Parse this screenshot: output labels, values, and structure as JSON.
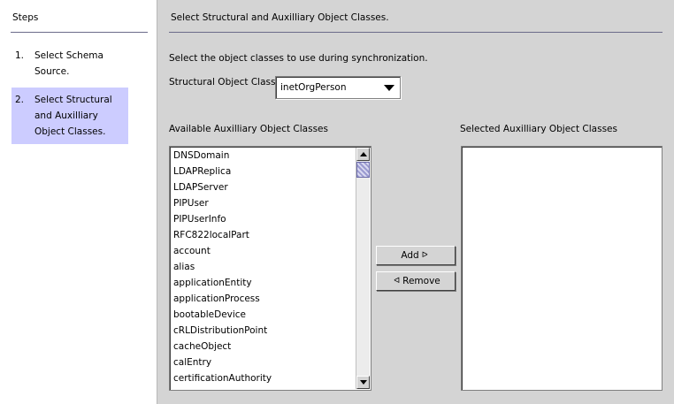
{
  "steps": {
    "title": "Steps",
    "items": [
      {
        "num": "1.",
        "label": "Select Schema Source.",
        "active": false
      },
      {
        "num": "2.",
        "label": "Select Structural and Auxilliary Object Classes.",
        "active": true
      }
    ]
  },
  "main": {
    "title": "Select Structural and Auxilliary Object Classes.",
    "instruction": "Select the object classes to use during synchronization.",
    "structural_label": "Structural Object Class :",
    "structural_value": "inetOrgPerson",
    "available_label": "Available Auxilliary Object Classes",
    "selected_label": "Selected Auxilliary Object Classes",
    "available_items": [
      "DNSDomain",
      "LDAPReplica",
      "LDAPServer",
      "PIPUser",
      "PIPUserInfo",
      "RFC822localPart",
      "account",
      "alias",
      "applicationEntity",
      "applicationProcess",
      "bootableDevice",
      "cRLDistributionPoint",
      "cacheObject",
      "calEntry",
      "certificationAuthority"
    ],
    "selected_items": [],
    "add_label": "Add",
    "remove_label": "Remove"
  }
}
